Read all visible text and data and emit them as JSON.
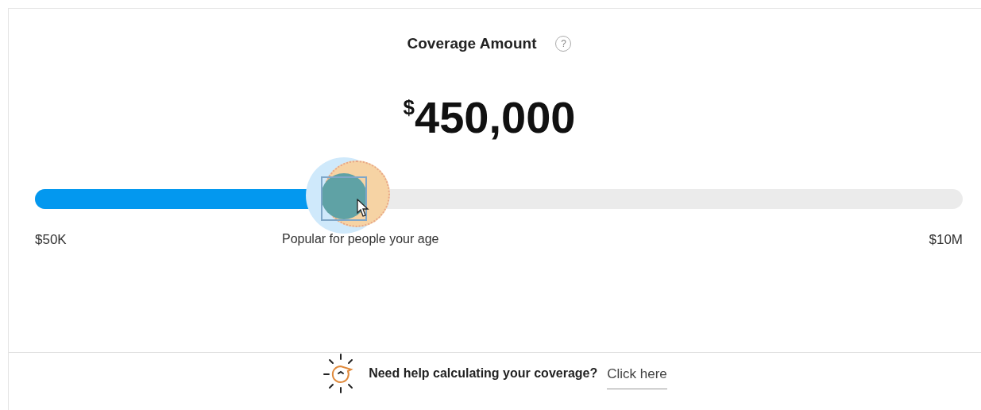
{
  "title": "Coverage Amount",
  "help_icon": "?",
  "amount": {
    "currency": "$",
    "value": "450,000"
  },
  "slider": {
    "level": 0.333,
    "min_label": "$50K",
    "max_label": "$10M",
    "hint": "Popular for people your age"
  },
  "help": {
    "prompt": "Need help calculating your coverage?",
    "link": "Click here"
  }
}
